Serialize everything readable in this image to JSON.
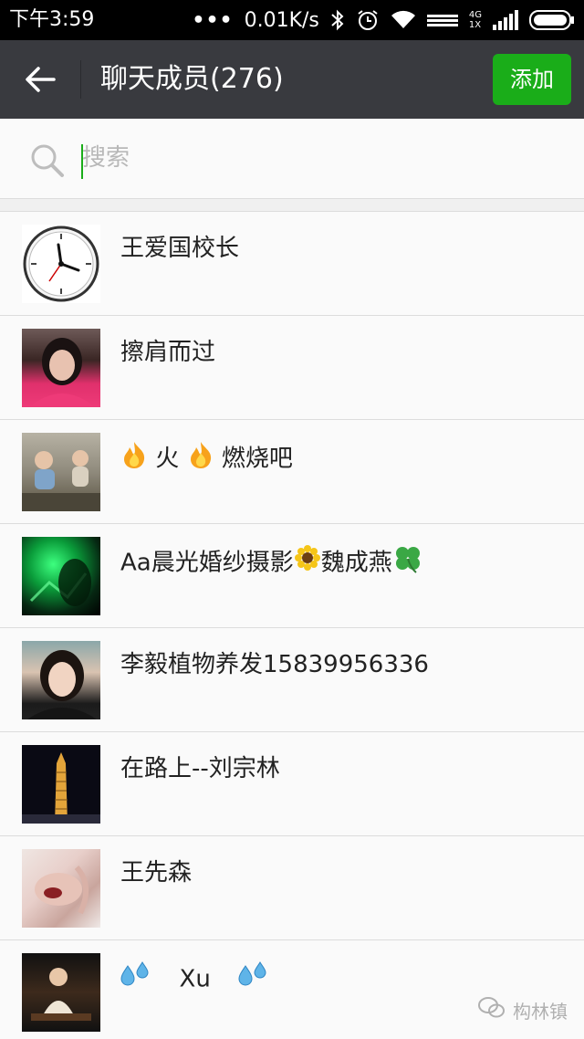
{
  "status_bar": {
    "time": "下午3:59",
    "dots": "•••",
    "net_speed": "0.01K/s",
    "network_top": "4G",
    "network_bottom": "1X"
  },
  "header": {
    "title": "聊天成员(276)",
    "add_label": "添加"
  },
  "search": {
    "placeholder": "搜索"
  },
  "members": [
    {
      "name": "王爱国校长",
      "avatar": "clock"
    },
    {
      "name": "擦肩而过",
      "avatar": "girl"
    },
    {
      "name_parts": [
        "火",
        "燃烧吧"
      ],
      "avatar": "kids"
    },
    {
      "name_parts": [
        "Aa晨光婚纱摄影",
        "魏成燕"
      ],
      "avatar": "green"
    },
    {
      "name": "李毅植物养发15839956336",
      "avatar": "woman"
    },
    {
      "name": "在路上--刘宗林",
      "avatar": "tower"
    },
    {
      "name": "王先森",
      "avatar": "hand"
    },
    {
      "name": "Xu",
      "avatar": "tea"
    }
  ],
  "watermark": {
    "text": "构林镇"
  },
  "colors": {
    "titlebar": "#393a3f",
    "accent": "#1aad19",
    "list_bg": "#fafafa"
  }
}
